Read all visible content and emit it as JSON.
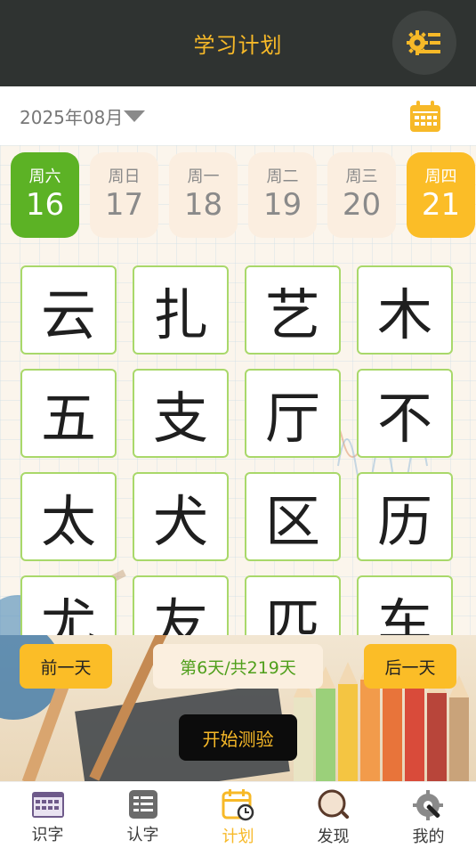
{
  "header": {
    "title": "学习计划",
    "settings_icon": "settings-icon"
  },
  "month_bar": {
    "month_label": "2025年08月",
    "calendar_icon": "calendar-icon"
  },
  "days": [
    {
      "weekday": "周六",
      "date": "16",
      "state": "today"
    },
    {
      "weekday": "周日",
      "date": "17",
      "state": "normal"
    },
    {
      "weekday": "周一",
      "date": "18",
      "state": "normal"
    },
    {
      "weekday": "周二",
      "date": "19",
      "state": "normal"
    },
    {
      "weekday": "周三",
      "date": "20",
      "state": "normal"
    },
    {
      "weekday": "周四",
      "date": "21",
      "state": "selected"
    }
  ],
  "characters": [
    "云",
    "扎",
    "艺",
    "木",
    "五",
    "支",
    "厅",
    "不",
    "太",
    "犬",
    "区",
    "历",
    "尤",
    "友",
    "匹",
    "车"
  ],
  "controls": {
    "prev_day": "前一天",
    "progress": "第6天/共219天",
    "next_day": "后一天",
    "start_quiz": "开始测验"
  },
  "tabbar": [
    {
      "label": "识字",
      "icon": "keyboard-icon",
      "active": false
    },
    {
      "label": "认字",
      "icon": "card-list-icon",
      "active": false
    },
    {
      "label": "计划",
      "icon": "calendar-clock-icon",
      "active": true
    },
    {
      "label": "发现",
      "icon": "magnifier-icon",
      "active": false
    },
    {
      "label": "我的",
      "icon": "gear-wrench-icon",
      "active": false
    }
  ],
  "colors": {
    "header_bg": "#2f3331",
    "accent_yellow": "#fbbd27",
    "accent_green": "#5cb225",
    "card_border": "#a9d86a"
  }
}
